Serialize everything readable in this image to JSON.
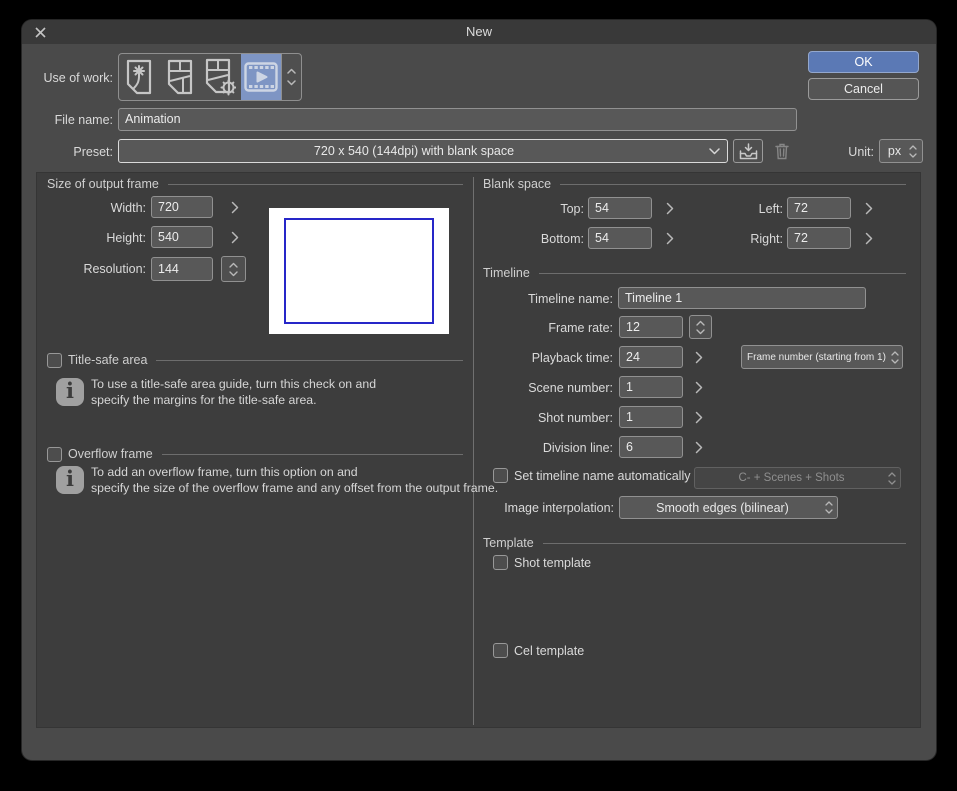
{
  "window": {
    "title": "New"
  },
  "colors": {
    "accent_blue": "#5b79b5",
    "selected_icon_bg": "#7e95c4",
    "canvas_frame_blue": "#2626c8",
    "window_bg": "#4a4a4a",
    "panel_bg": "#3d3d3d"
  },
  "header": {
    "use_of_work_label": "Use of work:",
    "work_types": [
      "illustration",
      "comic",
      "comic-show-all-settings",
      "animation"
    ],
    "selected_work_type": "animation",
    "ok_button": "OK",
    "cancel_button": "Cancel",
    "file_name_label": "File name:",
    "file_name_value": "Animation",
    "preset_label": "Preset:",
    "preset_value": "720 x 540 (144dpi) with blank space",
    "unit_label": "Unit:",
    "unit_value": "px"
  },
  "output_frame": {
    "section_title": "Size of output frame",
    "width_label": "Width:",
    "width_value": "720",
    "height_label": "Height:",
    "height_value": "540",
    "resolution_label": "Resolution:",
    "resolution_value": "144"
  },
  "title_safe": {
    "label": "Title-safe area",
    "checked": false,
    "info_line1": "To use a title-safe area guide, turn this check on and",
    "info_line2": "specify the margins for the title-safe area."
  },
  "overflow": {
    "label": "Overflow frame",
    "checked": false,
    "info_line1": "To add an overflow frame, turn this option on and",
    "info_line2": "specify the size of the overflow frame and any offset from the output frame."
  },
  "blank_space": {
    "section_title": "Blank space",
    "top_label": "Top:",
    "top_value": "54",
    "bottom_label": "Bottom:",
    "bottom_value": "54",
    "left_label": "Left:",
    "left_value": "72",
    "right_label": "Right:",
    "right_value": "72"
  },
  "timeline": {
    "section_title": "Timeline",
    "name_label": "Timeline name:",
    "name_value": "Timeline 1",
    "frame_rate_label": "Frame rate:",
    "frame_rate_value": "12",
    "playback_time_label": "Playback time:",
    "playback_time_value": "24",
    "playback_unit_value": "Frame number (starting from 1)",
    "scene_label": "Scene number:",
    "scene_value": "1",
    "shot_label": "Shot number:",
    "shot_value": "1",
    "division_label": "Division line:",
    "division_value": "6",
    "auto_name_label": "Set timeline name automatically",
    "auto_name_checked": false,
    "auto_name_pattern_value": "C- + Scenes + Shots",
    "interpolation_label": "Image interpolation:",
    "interpolation_value": "Smooth edges (bilinear)"
  },
  "template": {
    "section_title": "Template",
    "shot_label": "Shot template",
    "shot_checked": false,
    "cel_label": "Cel template",
    "cel_checked": false
  }
}
